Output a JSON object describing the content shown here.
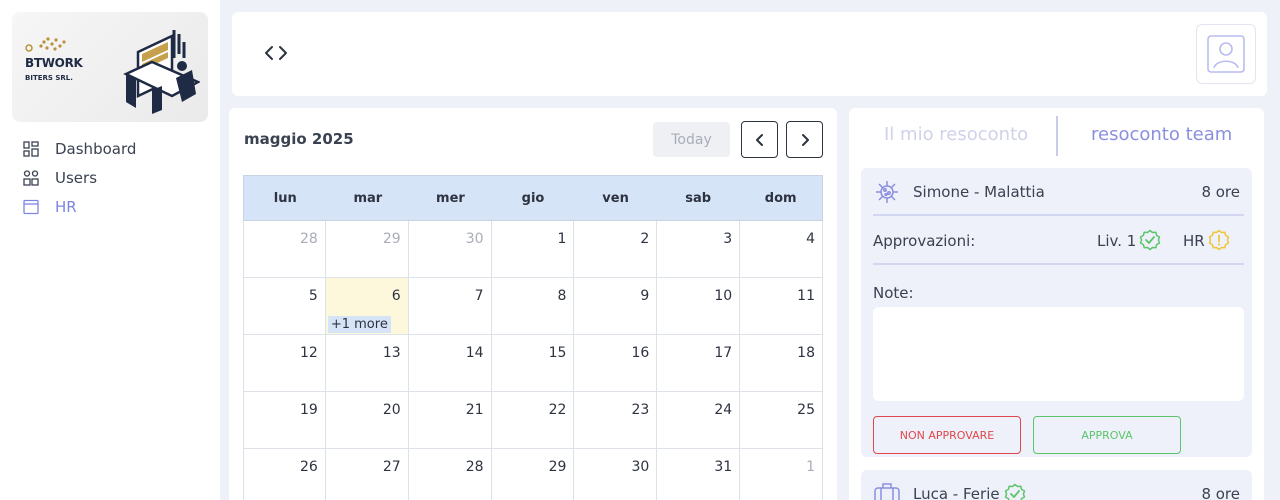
{
  "logo": {
    "name": "BTWORK",
    "company": "BITERS SRL."
  },
  "sidebar": {
    "items": [
      {
        "label": "Dashboard",
        "icon": "dashboard-icon"
      },
      {
        "label": "Users",
        "icon": "users-icon"
      },
      {
        "label": "HR",
        "icon": "hr-icon",
        "active": true
      }
    ]
  },
  "topbar": {
    "code_icon": "code-icon",
    "avatar_icon": "user-avatar-icon"
  },
  "calendar": {
    "title": "maggio 2025",
    "today_label": "Today",
    "weekdays": [
      "lun",
      "mar",
      "mer",
      "gio",
      "ven",
      "sab",
      "dom"
    ],
    "weeks": [
      [
        {
          "d": "28",
          "muted": true
        },
        {
          "d": "29",
          "muted": true
        },
        {
          "d": "30",
          "muted": true
        },
        {
          "d": "1"
        },
        {
          "d": "2"
        },
        {
          "d": "3"
        },
        {
          "d": "4"
        }
      ],
      [
        {
          "d": "5"
        },
        {
          "d": "6",
          "today": true,
          "more": "+1 more"
        },
        {
          "d": "7"
        },
        {
          "d": "8"
        },
        {
          "d": "9"
        },
        {
          "d": "10"
        },
        {
          "d": "11"
        }
      ],
      [
        {
          "d": "12"
        },
        {
          "d": "13"
        },
        {
          "d": "14"
        },
        {
          "d": "15"
        },
        {
          "d": "16"
        },
        {
          "d": "17"
        },
        {
          "d": "18"
        }
      ],
      [
        {
          "d": "19"
        },
        {
          "d": "20"
        },
        {
          "d": "21"
        },
        {
          "d": "22"
        },
        {
          "d": "23"
        },
        {
          "d": "24"
        },
        {
          "d": "25"
        }
      ],
      [
        {
          "d": "26"
        },
        {
          "d": "27"
        },
        {
          "d": "28"
        },
        {
          "d": "29"
        },
        {
          "d": "30"
        },
        {
          "d": "31"
        },
        {
          "d": "1",
          "muted": true
        }
      ]
    ]
  },
  "report": {
    "tab_mine": "Il mio resoconto",
    "tab_team": "resoconto team",
    "requests": [
      {
        "name": "Simone - Malattia",
        "hours": "8 ore",
        "icon": "virus-icon",
        "approvals_label": "Approvazioni:",
        "level1_label": "Liv. 1",
        "level1_status": "approved",
        "hr_label": "HR",
        "hr_status": "pending",
        "note_label": "Note:",
        "note_value": "",
        "reject_label": "NON APPROVARE",
        "approve_label": "APPROVA"
      },
      {
        "name": "Luca - Ferie",
        "hours": "8 ore",
        "icon": "suitcase-icon",
        "status": "approved"
      }
    ]
  },
  "colors": {
    "accent": "#7d86e0",
    "approved": "#5cc46b",
    "pending": "#f0c53a",
    "reject": "#e0474c",
    "calendar_header": "#d6e4f8",
    "today_bg": "#fdf7db"
  }
}
